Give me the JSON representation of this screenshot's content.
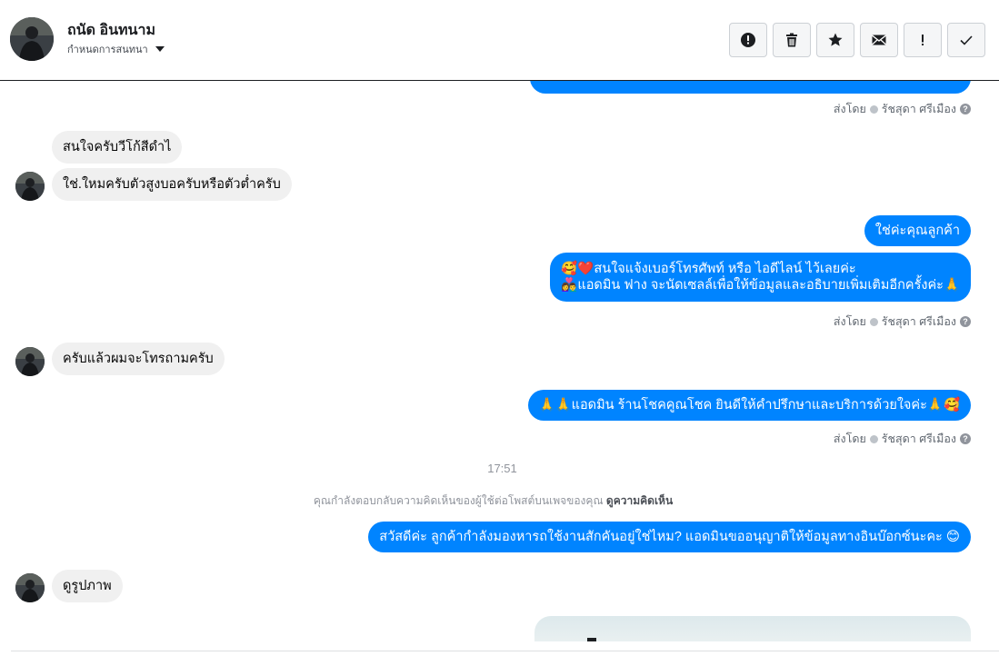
{
  "header": {
    "contact_name": "ถนัด อินทนาม",
    "assign_label": "กำหนดการสนทนา",
    "toolbar": [
      {
        "icon": "alert-circle-icon",
        "name": "spam-button"
      },
      {
        "icon": "trash-icon",
        "name": "delete-button"
      },
      {
        "icon": "star-icon",
        "name": "follow-up-button"
      },
      {
        "icon": "envelope-icon",
        "name": "mark-unread-button"
      },
      {
        "icon": "exclamation-icon",
        "name": "priority-button"
      },
      {
        "icon": "check-icon",
        "name": "mark-done-button"
      }
    ]
  },
  "messages": {
    "m1_sent_by": "ส่งโดย",
    "m1_agent": "รัชสุดา ศรีเมือง",
    "in1": "สนใจครับวีโก้สีดำไ",
    "in2": "ใช่.ใหมครับตัวสูงบอครับหรือตัวต่ำครับ",
    "out1": "ใช่ค่ะคุณลูกค้า",
    "out2_line1": "🥰❤️สนใจแจ้งเบอร์โทรศัพท์ หรือ ไอดีไลน์  ไว้เลยค่ะ",
    "out2_line2": "👩‍❤️‍👨แอดมิน ฟาง จะนัดเซลล์เพื่อให้ข้อมูลและอธิบายเพิ่มเติมอีกครั้งค่ะ🙏",
    "m2_sent_by": "ส่งโดย",
    "m2_agent": "รัชสุดา ศรีเมือง",
    "in3": "ครับแล้วผมจะโทรถามครับ",
    "out3": "🙏🙏แอดมิน ร้านโชคคูณโชค ยินดีให้คำปรึกษาและบริการด้วยใจค่ะ🙏🥰",
    "m3_sent_by": "ส่งโดย",
    "m3_agent": "รัชสุดา ศรีเมือง",
    "timestamp": "17:51",
    "notice_text": "คุณกำลังตอบกลับความคิดเห็นของผู้ใช้ต่อโพสต์บนเพจของคุณ ",
    "notice_link": "ดูความคิดเห็น",
    "out4": "สวัสดีค่ะ ลูกค้ากำลังมองหารถใช้งานสักคันอยู่ใช่ไหม? แอดมินขออนุญาติให้ข้อมูลทางอินบ๊อกซ์นะคะ 😊",
    "in4": "ดูรูปภาพ"
  },
  "colors": {
    "accent": "#0084ff",
    "incoming_bubble": "#f0f0f0"
  }
}
